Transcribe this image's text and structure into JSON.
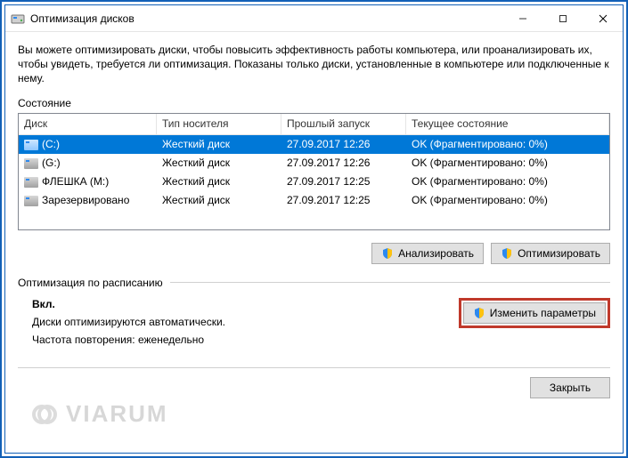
{
  "window": {
    "title": "Оптимизация дисков"
  },
  "description": "Вы можете оптимизировать диски, чтобы повысить эффективность работы компьютера, или проанализировать их, чтобы увидеть, требуется ли оптимизация. Показаны только диски, установленные в компьютере или подключенные к нему.",
  "state_label": "Состояние",
  "columns": {
    "drive": "Диск",
    "media": "Тип носителя",
    "last": "Прошлый запуск",
    "status": "Текущее состояние"
  },
  "drives": [
    {
      "name": "(C:)",
      "media": "Жесткий диск",
      "last": "27.09.2017 12:26",
      "status": "OK (Фрагментировано: 0%)",
      "selected": true
    },
    {
      "name": "(G:)",
      "media": "Жесткий диск",
      "last": "27.09.2017 12:26",
      "status": "OK (Фрагментировано: 0%)",
      "selected": false
    },
    {
      "name": "ФЛЕШКА (M:)",
      "media": "Жесткий диск",
      "last": "27.09.2017 12:25",
      "status": "OK (Фрагментировано: 0%)",
      "selected": false
    },
    {
      "name": "Зарезервировано",
      "media": "Жесткий диск",
      "last": "27.09.2017 12:25",
      "status": "OK (Фрагментировано: 0%)",
      "selected": false
    }
  ],
  "buttons": {
    "analyze": "Анализировать",
    "optimize": "Оптимизировать",
    "change_settings": "Изменить параметры",
    "close": "Закрыть"
  },
  "schedule": {
    "header": "Оптимизация по расписанию",
    "status": "Вкл.",
    "line1": "Диски оптимизируются автоматически.",
    "line2": "Частота повторения: еженедельно"
  },
  "watermark": "VIARUM"
}
